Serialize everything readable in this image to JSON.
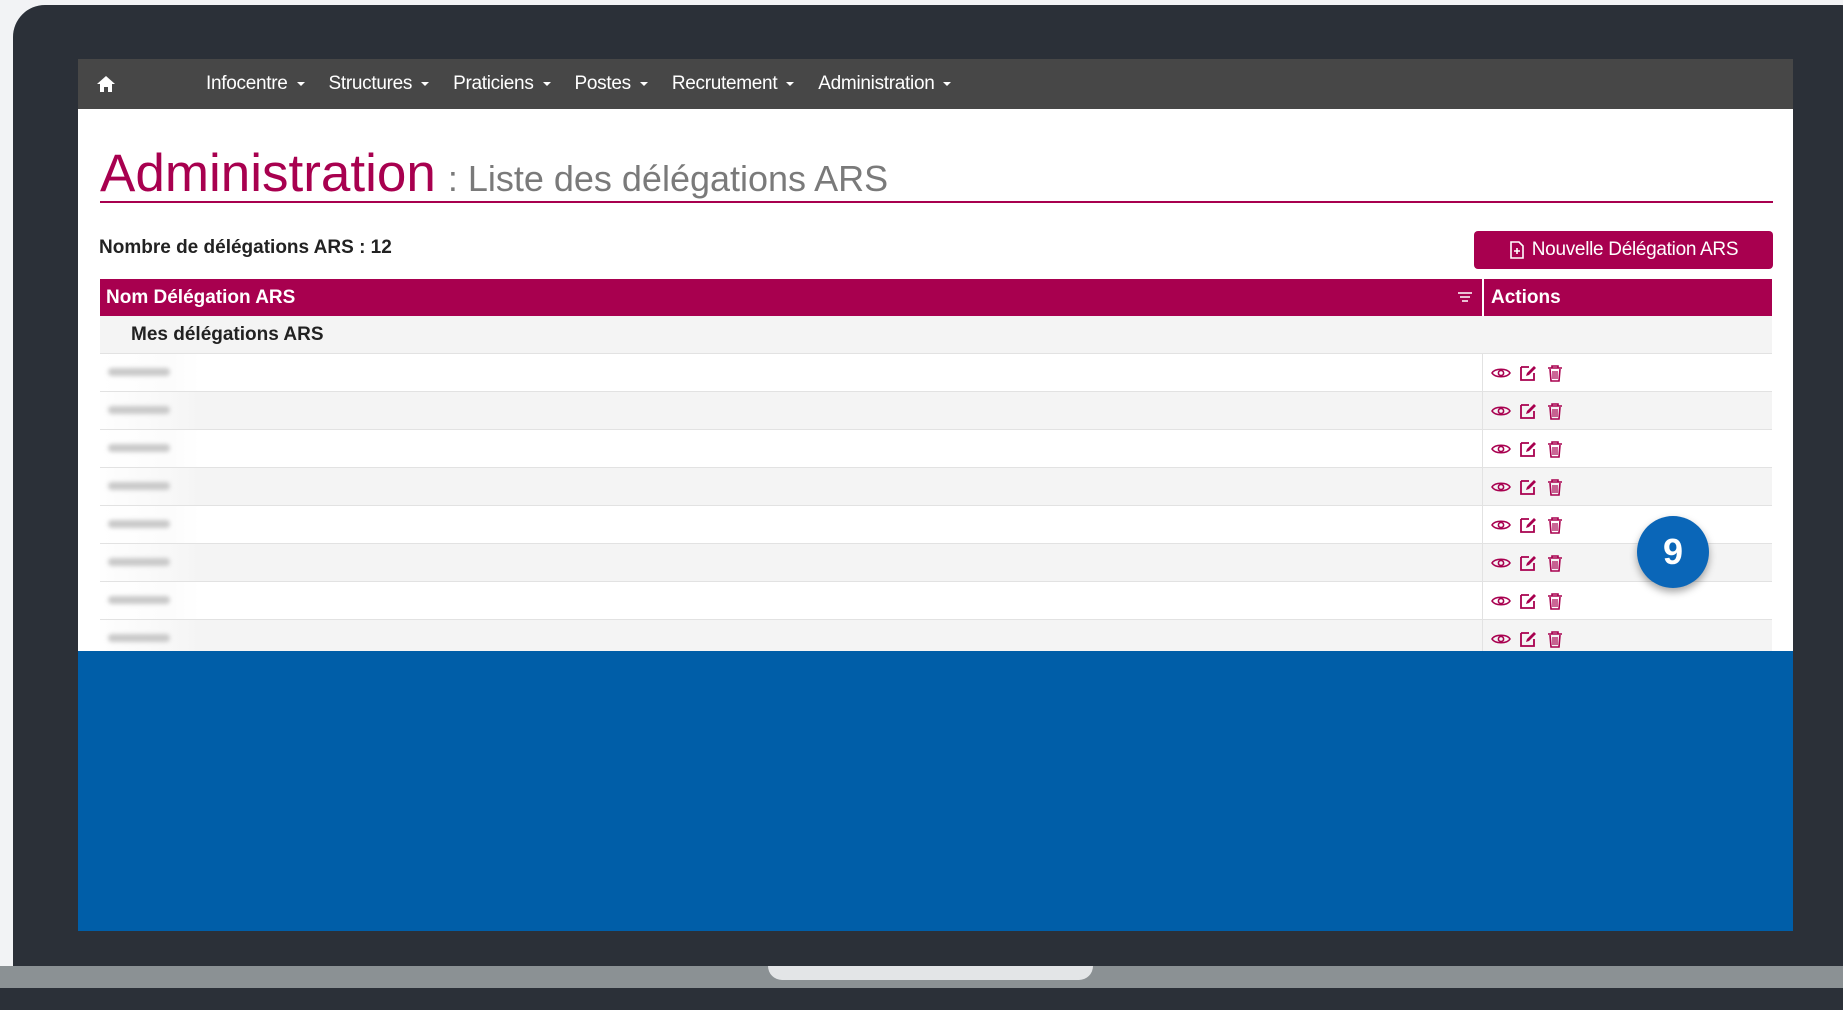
{
  "navbar": {
    "home_icon": "home-icon",
    "items": [
      {
        "label": "Infocentre"
      },
      {
        "label": "Structures"
      },
      {
        "label": "Praticiens"
      },
      {
        "label": "Postes"
      },
      {
        "label": "Recrutement"
      },
      {
        "label": "Administration"
      }
    ]
  },
  "header": {
    "title": "Administration",
    "subtitle": ": Liste des délégations ARS"
  },
  "summary": {
    "count_label": "Nombre de délégations ARS : 12"
  },
  "toolbar": {
    "new_button_label": "Nouvelle Délégation ARS",
    "new_button_icon": "file-plus-icon"
  },
  "table": {
    "columns": [
      "Nom Délégation ARS",
      "Actions"
    ],
    "group_label": "Mes délégations ARS",
    "row_count": 8,
    "action_icons": [
      "eye-icon",
      "edit-icon",
      "trash-icon"
    ]
  },
  "annotation": {
    "step_number": "9"
  },
  "colors": {
    "brand": "#a8004f",
    "navbar": "#474747",
    "screen_blue": "#005ea8",
    "badge": "#0a66b8",
    "bezel": "#2b3038"
  }
}
